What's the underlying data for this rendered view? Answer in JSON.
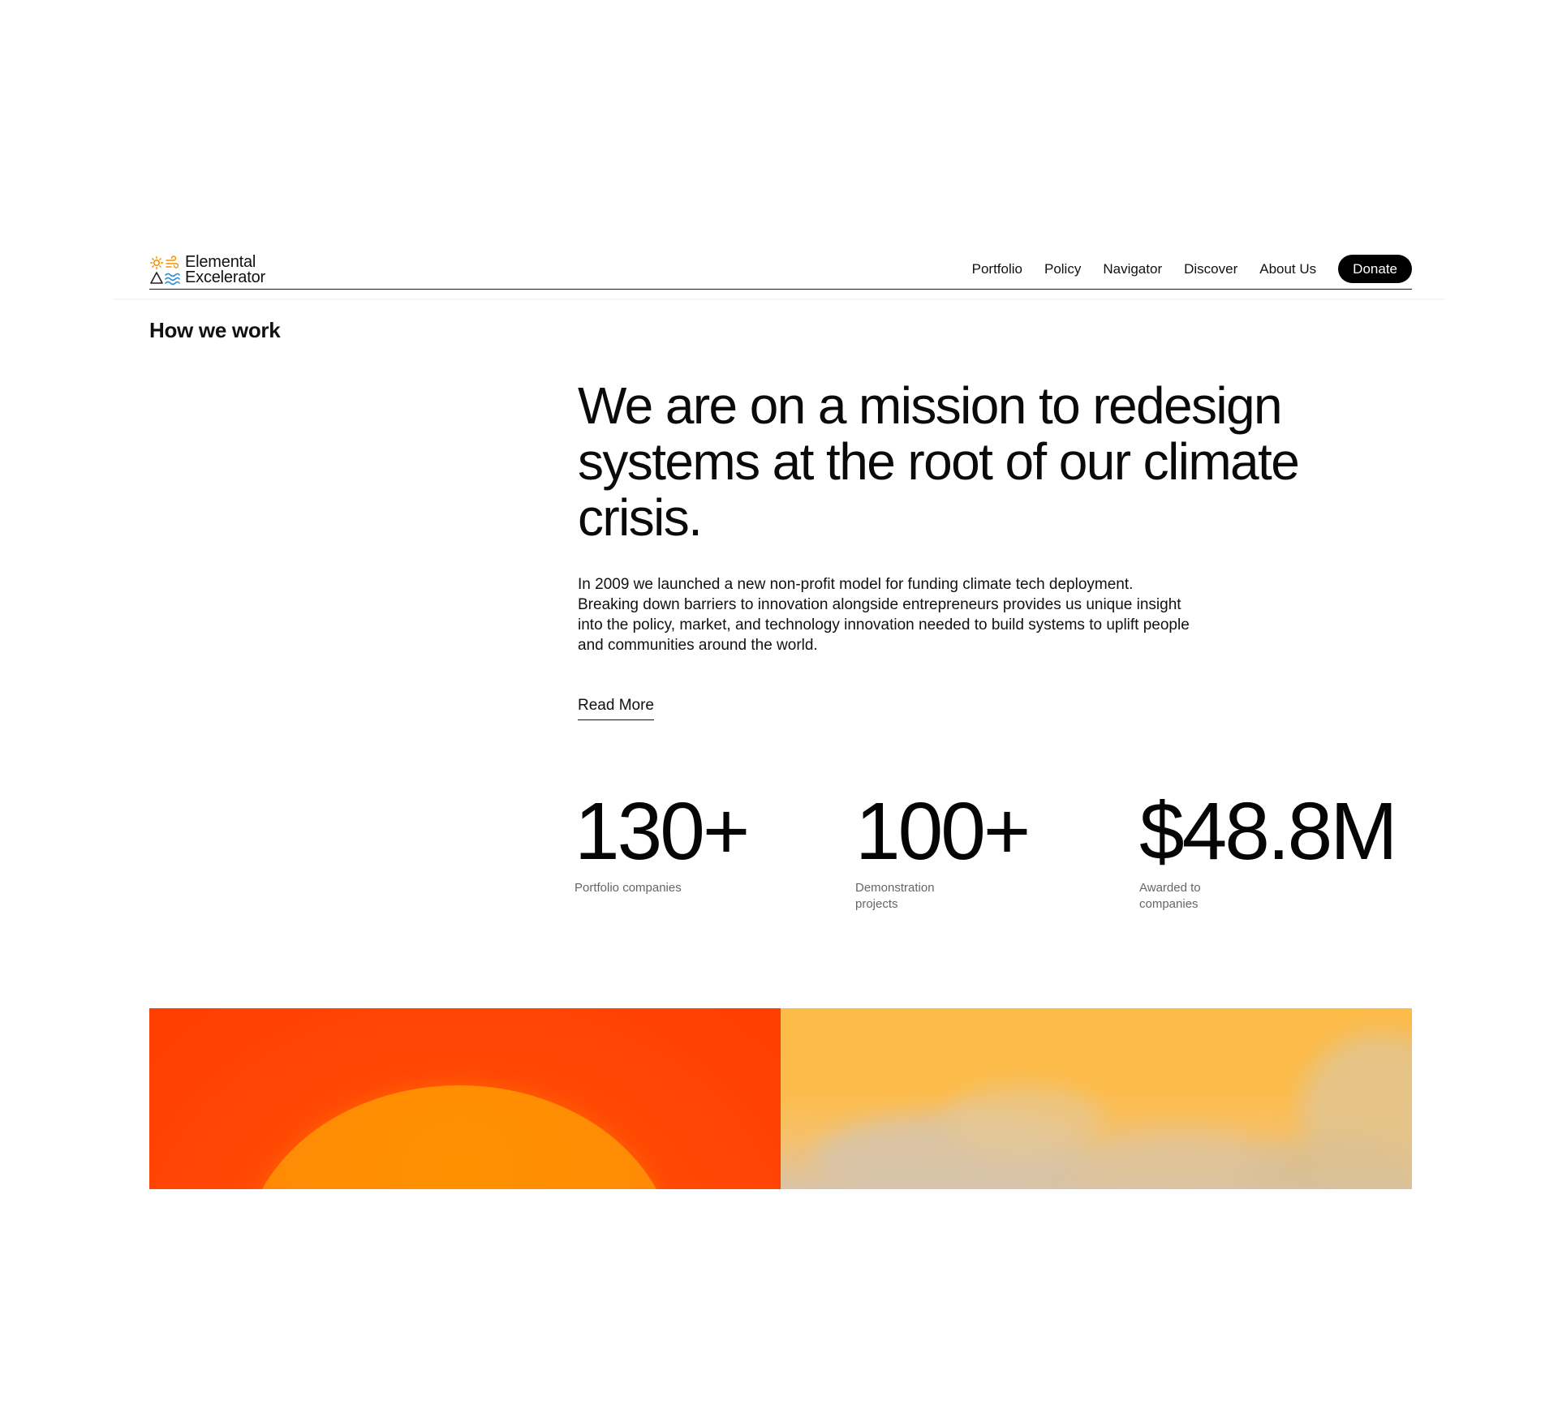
{
  "brand": {
    "name_line1": "Elemental",
    "name_line2": "Excelerator",
    "colors": {
      "sun": "#f39200",
      "wave": "#2f8fd0",
      "mountain": "#222222"
    }
  },
  "nav": {
    "items": [
      {
        "label": "Portfolio"
      },
      {
        "label": "Policy"
      },
      {
        "label": "Navigator"
      },
      {
        "label": "Discover"
      },
      {
        "label": "About Us"
      }
    ],
    "donate_label": "Donate"
  },
  "section": {
    "label": "How we work"
  },
  "hero": {
    "headline": "We are on a mission to redesign systems at the root of our climate crisis.",
    "body": "In 2009 we launched a new non-profit model for funding climate tech deployment. Breaking down barriers to innovation alongside entrepreneurs provides us unique insight into the policy, market, and technology innovation needed to build systems to uplift people and communities around the world.",
    "read_more_label": "Read More"
  },
  "stats": [
    {
      "value": "130+",
      "label": "Portfolio companies"
    },
    {
      "value": "100+",
      "label": "Demonstration\nprojects"
    },
    {
      "value": "$48.8M",
      "label": "Awarded to\ncompanies"
    }
  ],
  "banner": {
    "colors": {
      "left_bg": "#ff4305",
      "sun": "#ff8c05",
      "right_bg": "#fdbb48",
      "clouds": "#d6c4ac"
    }
  }
}
